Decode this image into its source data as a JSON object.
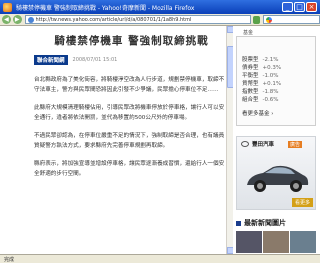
{
  "window": {
    "title": "騎樓禁停機車 警強制取締挑戰 - Yahoo!奇摩新聞 - Mozilla Firefox",
    "minimize": "_",
    "maximize": "□",
    "close": "×"
  },
  "addressbar": {
    "back": "◀",
    "forward": "▶",
    "url": "http://tw.news.yahoo.com/article/url/d/a/080701/1/1a8h9.html",
    "search_placeholder": "Google"
  },
  "article": {
    "headline": "騎樓禁停機車 警強制取締挑戰",
    "source": "聯合新聞網",
    "date": "2008/07/01 15:01",
    "paragraphs": [
      "台北縣政府為了美化街容，將騎樓淨空改為人行步道，規劃禁停機車，取締不守法車主，警方與民眾間恐將因此引發不少爭議，民眾擔心停車位不足……",
      "此縣府大規模清理騎樓佔用，引導民眾改將機車停放於停車格，讓行人可以安全通行，違者將依法開罰，並代為移置約500公尺外的停車場。",
      "不過民眾卻認為，在停車位嚴重不足的情況下，強制取締是否合理，也有議員質疑警方執法方式，要求縣府先完善停車規劃再取締。",
      "縣府表示，將加強宣導並增設停車格，讓民眾逐漸養成習慣，還給行人一個安全舒適的步行空間。"
    ]
  },
  "sidebar": {
    "top_link": "基金",
    "funds": [
      {
        "name": "股票型",
        "value": "-2.1%"
      },
      {
        "name": "債券型",
        "value": "+0.3%"
      },
      {
        "name": "平衡型",
        "value": "-1.0%"
      },
      {
        "name": "貨幣型",
        "value": "+0.1%"
      },
      {
        "name": "指數型",
        "value": "-1.8%"
      },
      {
        "name": "組合型",
        "value": "-0.6%"
      }
    ],
    "fund_footer": "看更多基金 ›",
    "ad_brand": "豐田汽車",
    "ad_tag": "廣告",
    "ad_cta": "看更多",
    "latest_title": "最新新聞圖片"
  },
  "status": {
    "text": "完成"
  }
}
